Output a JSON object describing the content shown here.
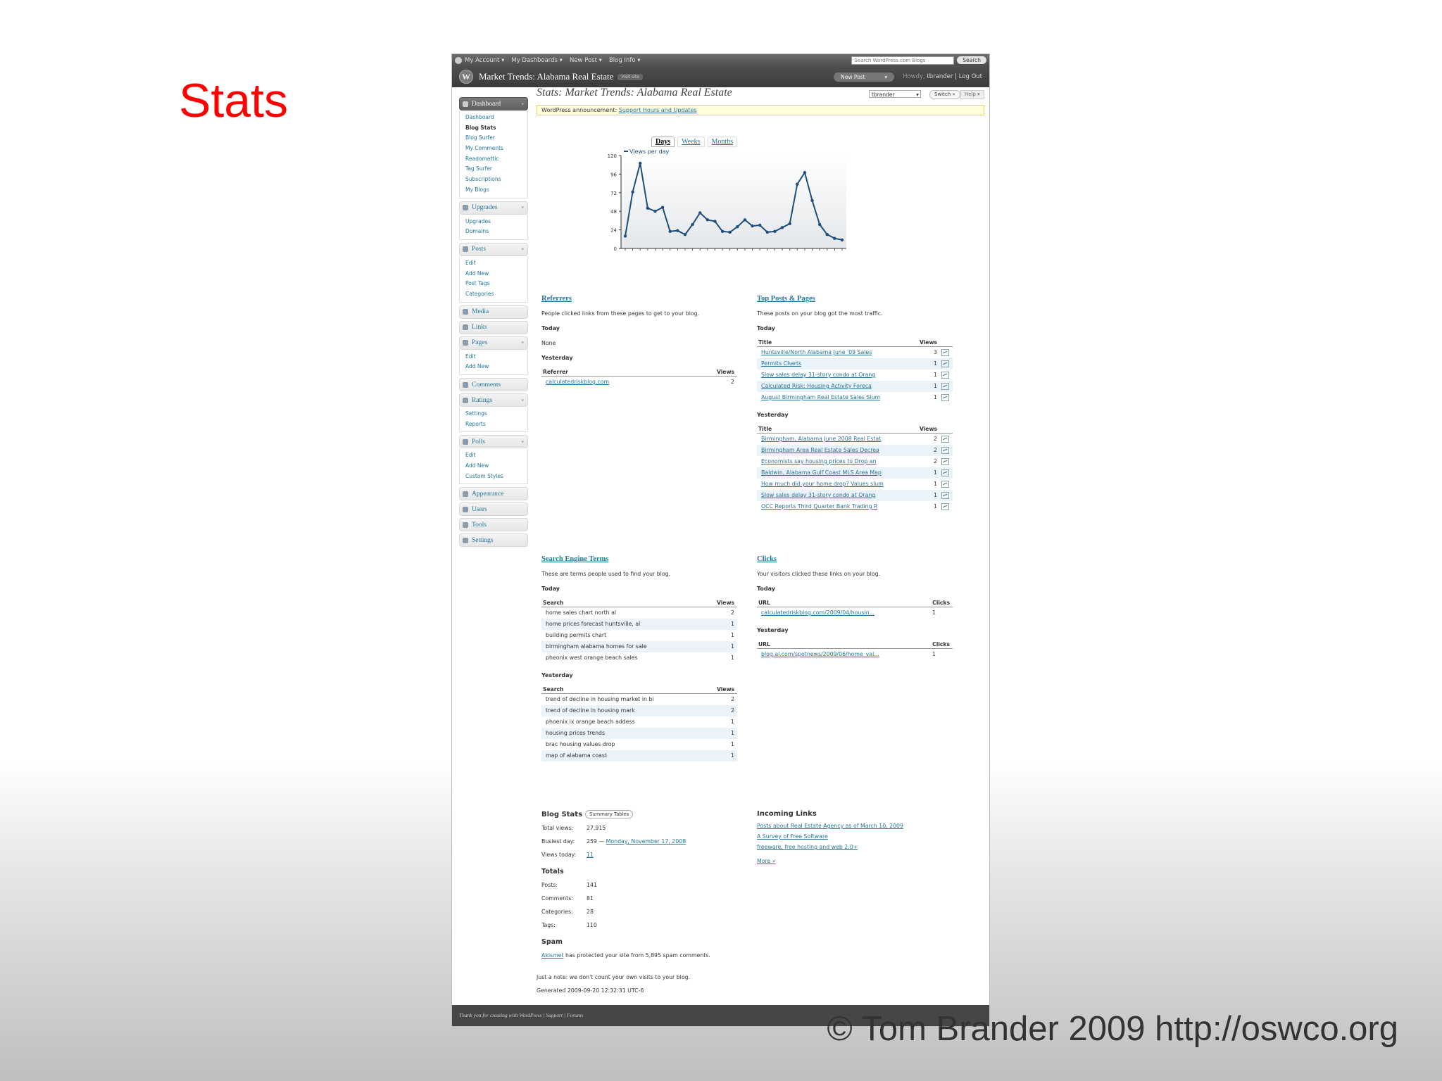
{
  "slide": {
    "title": "Stats",
    "copyright": "© Tom Brander 2009 http://oswco.org"
  },
  "adminbar": {
    "menus": [
      "My Account ▾",
      "My Dashboards ▾",
      "New Post ▾",
      "Blog Info ▾"
    ],
    "search_placeholder": "Search WordPress.com Blogs",
    "search_button": "Search"
  },
  "header": {
    "site_title": "Market Trends: Alabama Real Estate",
    "visit_site": "Visit site",
    "new_post": "New Post",
    "howdy": "Howdy,",
    "username": "tbrander",
    "logout": "| Log Out",
    "user_select": "tbrander",
    "switch": "Switch »",
    "help": "Help ▾"
  },
  "sidebar": {
    "groups": [
      {
        "label": "Dashboard",
        "active": true,
        "items": [
          "Dashboard",
          "Blog Stats",
          "Blog Surfer",
          "My Comments",
          "Readomattic",
          "Tag Surfer",
          "Subscriptions",
          "My Blogs"
        ]
      },
      {
        "label": "Upgrades",
        "items": [
          "Upgrades",
          "Domains"
        ]
      },
      {
        "label": "Posts",
        "items": [
          "Edit",
          "Add New",
          "Post Tags",
          "Categories"
        ]
      },
      {
        "label": "Media",
        "items": []
      },
      {
        "label": "Links",
        "items": []
      },
      {
        "label": "Pages",
        "items": [
          "Edit",
          "Add New"
        ]
      },
      {
        "label": "Comments",
        "items": []
      },
      {
        "label": "Ratings",
        "items": [
          "Settings",
          "Reports"
        ]
      },
      {
        "label": "Polls",
        "items": [
          "Edit",
          "Add New",
          "Custom Styles"
        ]
      },
      {
        "label": "Appearance",
        "items": []
      },
      {
        "label": "Users",
        "items": []
      },
      {
        "label": "Tools",
        "items": []
      },
      {
        "label": "Settings",
        "items": []
      }
    ]
  },
  "main": {
    "page_title": "Stats: Market Trends: Alabama Real Estate",
    "notice_prefix": "WordPress announcement:",
    "notice_link": "Support Hours and Updates",
    "tabs": [
      "Days",
      "Weeks",
      "Months"
    ]
  },
  "chart_data": {
    "type": "line",
    "series": [
      {
        "name": "Views per day",
        "values": [
          16,
          73,
          110,
          52,
          48,
          53,
          22,
          23,
          18,
          31,
          46,
          37,
          35,
          22,
          21,
          28,
          37,
          29,
          30,
          21,
          22,
          27,
          32,
          83,
          98,
          62,
          31,
          18,
          13,
          11
        ]
      }
    ],
    "ylim": [
      0,
      120
    ],
    "yticks": [
      0,
      24,
      48,
      72,
      96,
      120
    ],
    "grid": false,
    "legend": "top-left"
  },
  "referrers": {
    "title": "Referrers",
    "desc": "People clicked links from these pages to get to your blog.",
    "today_label": "Today",
    "today_none": "None",
    "yesterday_label": "Yesterday",
    "col_referrer": "Referrer",
    "col_views": "Views",
    "rows": [
      {
        "ref": "calculatedriskblog.com",
        "views": "2"
      }
    ]
  },
  "top_posts": {
    "title": "Top Posts & Pages",
    "desc": "These posts on your blog got the most traffic.",
    "today_label": "Today",
    "yesterday_label": "Yesterday",
    "col_title": "Title",
    "col_views": "Views",
    "today": [
      {
        "title": "Huntsville/North Alabama June '09 Sales",
        "views": "3"
      },
      {
        "title": "Permits Charts",
        "views": "1"
      },
      {
        "title": "Slow sales delay 31-story condo at Orang",
        "views": "1"
      },
      {
        "title": "Calculated Risk: Housing Activity Foreca",
        "views": "1"
      },
      {
        "title": "August Birmingham Real Estate Sales Slum",
        "views": "1"
      }
    ],
    "yesterday": [
      {
        "title": "Birmingham, Alabama June 2008 Real Estat",
        "views": "2"
      },
      {
        "title": "Birmingham Area Real Estate Sales Decrea",
        "views": "2"
      },
      {
        "title": "Economists say housing prices to Drop an",
        "views": "2"
      },
      {
        "title": "Baldwin, Alabama Gulf Coast MLS Area Map",
        "views": "1"
      },
      {
        "title": "How much did your home drop? Values slum",
        "views": "1"
      },
      {
        "title": "Slow sales delay 31-story condo at Orang",
        "views": "1"
      },
      {
        "title": "OCC Reports Third Quarter Bank Trading R",
        "views": "1"
      }
    ]
  },
  "search_terms": {
    "title": "Search Engine Terms",
    "desc": "These are terms people used to find your blog.",
    "today_label": "Today",
    "yesterday_label": "Yesterday",
    "col_search": "Search",
    "col_views": "Views",
    "today": [
      {
        "term": "home sales chart north al",
        "views": "2"
      },
      {
        "term": "home prices forecast huntsville, al",
        "views": "1"
      },
      {
        "term": "building permits chart",
        "views": "1"
      },
      {
        "term": "birmingham alabama homes for sale",
        "views": "1"
      },
      {
        "term": "pheonix west orange beach sales",
        "views": "1"
      }
    ],
    "yesterday": [
      {
        "term": "trend of decline in housing market in bi",
        "views": "2"
      },
      {
        "term": "trend of decline in housing mark",
        "views": "2"
      },
      {
        "term": "phoenix ix orange beach addess",
        "views": "1"
      },
      {
        "term": "housing prices trends",
        "views": "1"
      },
      {
        "term": "brac housing values drop",
        "views": "1"
      },
      {
        "term": "map of alabama coast",
        "views": "1"
      }
    ]
  },
  "clicks": {
    "title": "Clicks",
    "desc": "Your visitors clicked these links on your blog.",
    "today_label": "Today",
    "yesterday_label": "Yesterday",
    "col_url": "URL",
    "col_clicks": "Clicks",
    "today": [
      {
        "url": "calculatedriskblog.com/2009/04/housin...",
        "clicks": "1"
      }
    ],
    "yesterday": [
      {
        "url": "blog.al.com/spotnews/2009/06/home_val...",
        "clicks": "1"
      }
    ]
  },
  "blog_stats": {
    "title": "Blog Stats",
    "summary_btn": "Summary Tables",
    "total_views_label": "Total views:",
    "total_views": "27,915",
    "busiest_label": "Busiest day:",
    "busiest_count": "259 —",
    "busiest_date": "Monday, November 17, 2008",
    "views_today_label": "Views today:",
    "views_today": "11",
    "totals_title": "Totals",
    "posts_label": "Posts:",
    "posts": "141",
    "comments_label": "Comments:",
    "comments": "81",
    "categories_label": "Categories:",
    "categories": "28",
    "tags_label": "Tags:",
    "tags": "110",
    "spam_title": "Spam",
    "akismet": "Akismet",
    "spam_text": "has protected your site from 5,895 spam comments.",
    "note": "Just a note: we don't count your own visits to your blog.",
    "generated": "Generated 2009-09-20 12:32:31 UTC-6"
  },
  "incoming": {
    "title": "Incoming Links",
    "links": [
      "Posts about Real Estate Agency as of March 10, 2009",
      "A Survey of Free Software",
      "freeware, free hosting and web 2.0+"
    ],
    "more": "More »"
  },
  "footer": {
    "text": "Thank you for creating with WordPress | Support | Forums"
  }
}
